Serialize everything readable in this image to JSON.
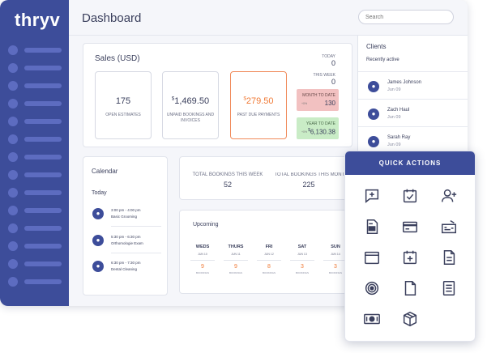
{
  "app": {
    "logo": "thryv"
  },
  "header": {
    "title": "Dashboard",
    "search_placeholder": "Search"
  },
  "sidebar": {
    "item_count": 14
  },
  "sales": {
    "title": "Sales",
    "currency": "(USD)",
    "boxes": [
      {
        "prefix": "",
        "value": "175",
        "label": "OPEN ESTIMATES"
      },
      {
        "prefix": "$",
        "value": "1,469.50",
        "label": "UNPAID BOOKINGS AND INVOICES"
      },
      {
        "prefix": "$",
        "value": "279.50",
        "label": "PAST DUE PAYMENTS"
      }
    ],
    "today_label": "TODAY",
    "today_value": "0",
    "week_label": "THIS WEEK",
    "week_value": "0",
    "mtd_label": "MONTH TO DATE",
    "mtd_sub": "+0%",
    "mtd_value": "130",
    "ytd_label": "YEAR TO DATE",
    "ytd_sub": "+0%",
    "ytd_value": "6,130.38"
  },
  "clients": {
    "title": "Clients",
    "subtitle": "Recently active",
    "items": [
      {
        "name": "James Johnson",
        "date": "Jun 09"
      },
      {
        "name": "Zach Haul",
        "date": "Jun 09"
      },
      {
        "name": "Sarah Ray",
        "date": "Jun 09"
      }
    ]
  },
  "calendar": {
    "title": "Calendar",
    "today": "Today",
    "appointments": [
      {
        "time": "3:00 pm - 4:00 pm",
        "desc": "Basic Grooming"
      },
      {
        "time": "5:30 pm - 6:30 pm",
        "desc": "Orthomologie Exam"
      },
      {
        "time": "6:30 pm - 7:30 pm",
        "desc": "Dental Cleaning"
      }
    ]
  },
  "bookings": {
    "week_label": "TOTAL BOOKINGS THIS WEEK",
    "week_value": "52",
    "month_label": "TOTAL BOOKINGS THIS MONTH",
    "month_value": "225"
  },
  "upcoming": {
    "title": "Upcoming",
    "days": [
      {
        "name": "WEDS",
        "date": "JUN 10",
        "count": "9",
        "label": "BOOKINGS"
      },
      {
        "name": "THURS",
        "date": "JUN 11",
        "count": "9",
        "label": "BOOKINGS"
      },
      {
        "name": "FRI",
        "date": "JUN 12",
        "count": "8",
        "label": "BOOKINGS"
      },
      {
        "name": "SAT",
        "date": "JUN 13",
        "count": "3",
        "label": "BOOKINGS"
      },
      {
        "name": "SUN",
        "date": "JUN 14",
        "count": "3",
        "label": "BOOKINGS"
      }
    ]
  },
  "quick_actions": {
    "title": "QUICK ACTIONS",
    "icons": [
      "add-comment-icon",
      "task-check-icon",
      "add-user-icon",
      "invoice-doc-icon",
      "credit-card-icon",
      "check-payment-icon",
      "window-icon",
      "add-event-icon",
      "document-icon",
      "target-icon",
      "file-icon",
      "list-doc-icon",
      "cash-icon",
      "package-icon"
    ]
  },
  "colors": {
    "primary": "#3d4d9a",
    "accent": "#f07a36",
    "mtd_bg": "#f2c1c1",
    "ytd_bg": "#c9ecc6"
  }
}
